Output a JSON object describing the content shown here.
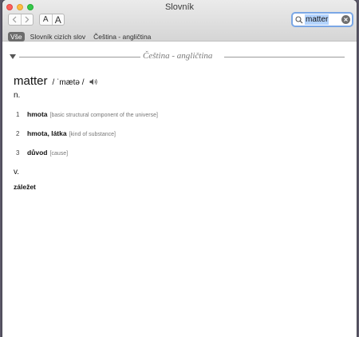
{
  "window": {
    "title": "Slovník"
  },
  "toolbar": {
    "font_smaller_label": "A",
    "font_larger_label": "A",
    "search": {
      "value": "matter"
    }
  },
  "scopes": [
    {
      "label": "Vše",
      "active": true
    },
    {
      "label": "Slovník cizích slov",
      "active": false
    },
    {
      "label": "Čeština - angličtina",
      "active": false
    }
  ],
  "entry": {
    "section_title": "Čeština - angličtina",
    "headword": "matter",
    "pronunciation": "/ ˈmætə /",
    "noun": {
      "pos": "n.",
      "senses": [
        {
          "num": "1",
          "word": "hmota",
          "gloss": "[basic structural component of the universe]"
        },
        {
          "num": "2",
          "word": "hmota, látka",
          "gloss": "[kind of substance]"
        },
        {
          "num": "3",
          "word": "důvod",
          "gloss": "[cause]"
        }
      ]
    },
    "verb": {
      "pos": "v.",
      "translation": "záležet"
    }
  },
  "colors": {
    "accent": "#7aa7e5",
    "selection": "#b3d3fd",
    "active_scope": "#6d6d6d"
  }
}
